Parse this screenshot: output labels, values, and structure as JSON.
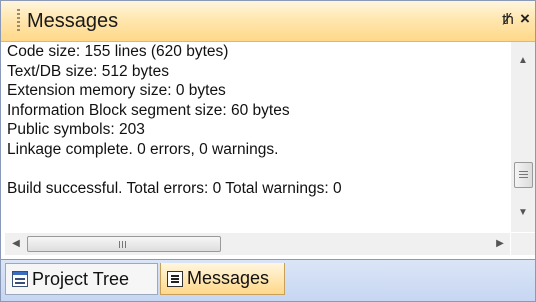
{
  "panel": {
    "title": "Messages",
    "pin_glyph": "ᵖ",
    "close_glyph": "×"
  },
  "messages": [
    "Code size: 155 lines (620 bytes)",
    "Text/DB size: 512 bytes",
    "Extension memory size: 0 bytes",
    "Information Block segment size: 60 bytes",
    "Public symbols: 203",
    "Linkage complete. 0 errors, 0 warnings.",
    "",
    "Build successful.  Total errors: 0  Total warnings: 0"
  ],
  "scrollbars": {
    "up_glyph": "▲",
    "down_glyph": "▼",
    "left_glyph": "◀",
    "right_glyph": "▶"
  },
  "tabs": [
    {
      "label": "Project Tree",
      "icon": "project-tree-icon"
    },
    {
      "label": "Messages",
      "icon": "messages-icon"
    }
  ]
}
